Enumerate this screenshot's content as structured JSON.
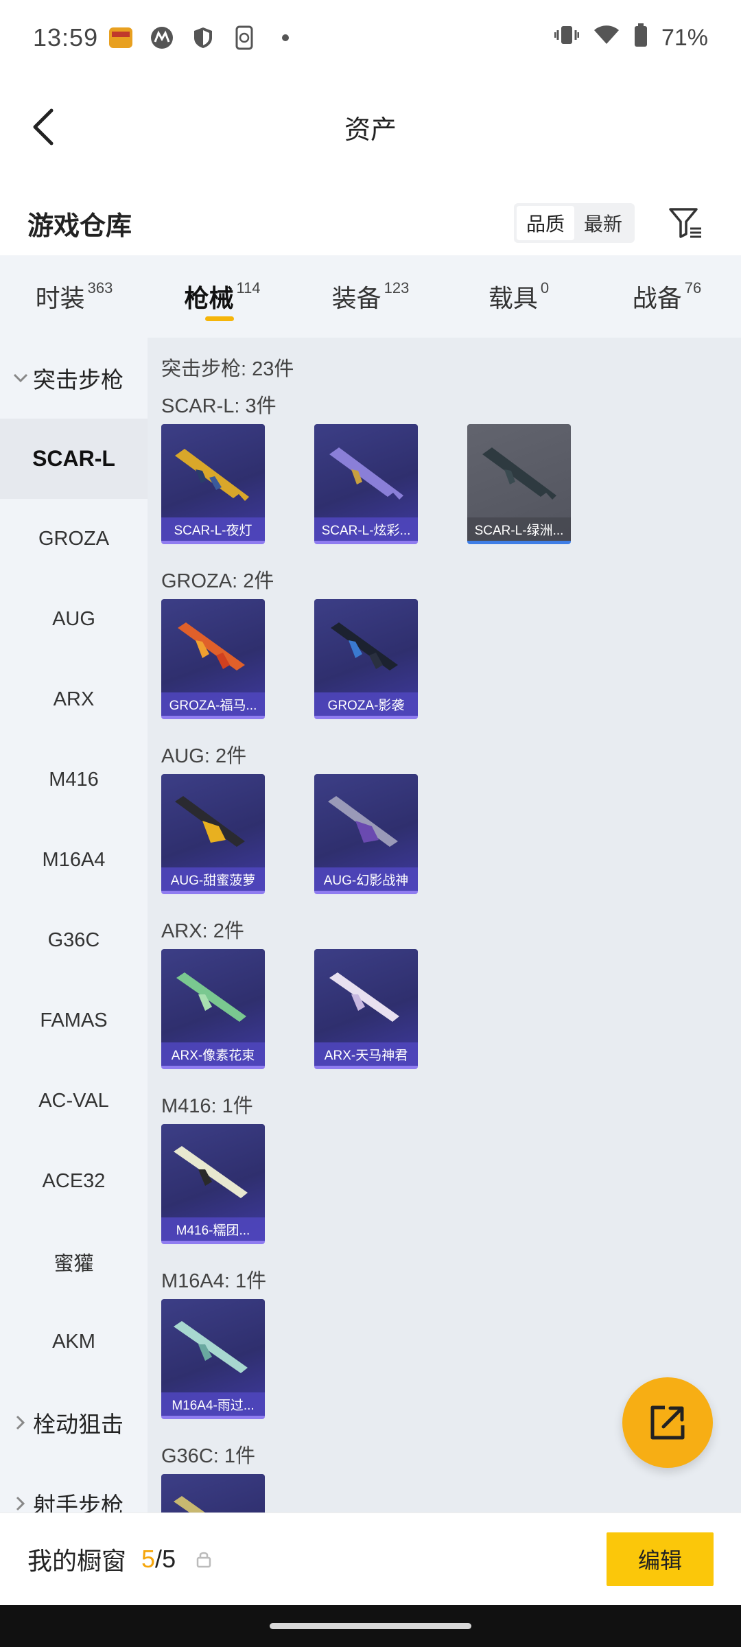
{
  "status_bar": {
    "time": "13:59",
    "battery": "71%",
    "icons": [
      "app-notification-icon",
      "motorola-icon",
      "shield-icon",
      "phone-sync-icon",
      "dot-icon",
      "vibrate-icon",
      "wifi-icon",
      "battery-icon"
    ]
  },
  "header": {
    "title": "资产"
  },
  "warehouse": {
    "title": "游戏仓库",
    "sort_quality": "品质",
    "sort_newest": "最新"
  },
  "tabs": [
    {
      "label": "时装",
      "count": "363"
    },
    {
      "label": "枪械",
      "count": "114",
      "active": true
    },
    {
      "label": "装备",
      "count": "123"
    },
    {
      "label": "载具",
      "count": "0"
    },
    {
      "label": "战备",
      "count": "76"
    }
  ],
  "sidebar": {
    "group_open": "突击步枪",
    "items": [
      "SCAR-L",
      "GROZA",
      "AUG",
      "ARX",
      "M416",
      "M16A4",
      "G36C",
      "FAMAS",
      "AC-VAL",
      "ACE32",
      "蜜獾",
      "AKM"
    ],
    "group_closed_1": "栓动狙击",
    "group_closed_2": "射手步枪"
  },
  "content": {
    "summary": "突击步枪: 23件",
    "groups": [
      {
        "title": "SCAR-L: 3件",
        "cards": [
          "SCAR-L-夜灯",
          "SCAR-L-炫彩...",
          "SCAR-L-绿洲..."
        ]
      },
      {
        "title": "GROZA: 2件",
        "cards": [
          "GROZA-福马...",
          "GROZA-影袭"
        ]
      },
      {
        "title": "AUG: 2件",
        "cards": [
          "AUG-甜蜜菠萝",
          "AUG-幻影战神"
        ]
      },
      {
        "title": "ARX: 2件",
        "cards": [
          "ARX-像素花束",
          "ARX-天马神君"
        ]
      },
      {
        "title": "M416: 1件",
        "cards": [
          "M416-糯团..."
        ]
      },
      {
        "title": "M16A4: 1件",
        "cards": [
          "M16A4-雨过..."
        ]
      },
      {
        "title": "G36C: 1件",
        "cards": [
          ""
        ]
      }
    ]
  },
  "bottom": {
    "label": "我的橱窗",
    "current": "5",
    "separator": "/",
    "total": "5",
    "edit": "编辑"
  },
  "colors": {
    "accent": "#f5b50a",
    "card_purple": "#3c3e86",
    "fab": "#f7ae14",
    "edit_button": "#fbc70a"
  }
}
